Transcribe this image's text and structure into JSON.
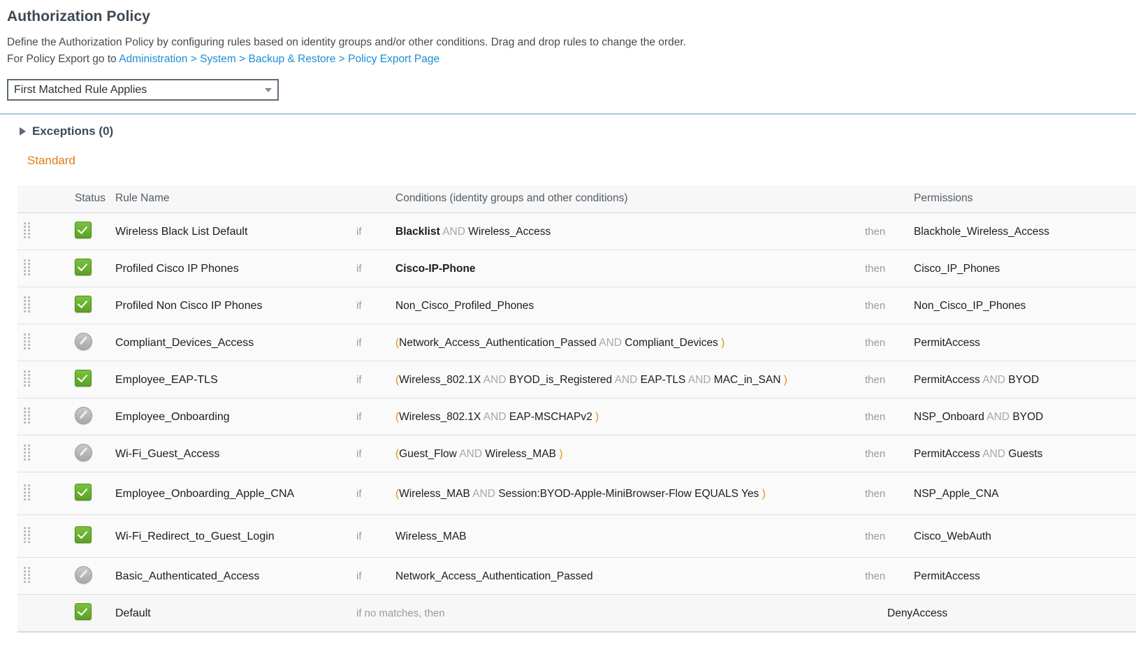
{
  "header": {
    "title": "Authorization Policy",
    "description_line1": "Define the Authorization Policy by configuring rules based on identity groups and/or other conditions. Drag and drop rules to change the order.",
    "description_prefix": "For Policy Export go to ",
    "breadcrumb": [
      {
        "label": "Administration"
      },
      {
        "label": "System"
      },
      {
        "label": "Backup & Restore"
      },
      {
        "label": "Policy Export Page"
      }
    ],
    "breadcrumb_separator": " > "
  },
  "rule_mode_select": {
    "value": "First Matched Rule Applies",
    "icon": "chevron-down-icon"
  },
  "exceptions": {
    "label": "Exceptions (0)",
    "expand_icon": "triangle-right-icon",
    "expanded": false
  },
  "standard_tab": {
    "label": "Standard"
  },
  "colors": {
    "accent_orange": "#e07b18",
    "link_blue": "#1a8fd4",
    "enabled_green": "#6ab32c",
    "disabled_gray": "#b4b4b4",
    "divider_blue": "#a9cbdd",
    "paren_orange": "#e8900f",
    "and_gray": "#a8a8a8"
  },
  "table": {
    "columns": {
      "status": "Status",
      "rule_name": "Rule Name",
      "conditions": "Conditions (identity groups and other conditions)",
      "permissions": "Permissions"
    },
    "keywords": {
      "if": "if",
      "then": "then",
      "if_no_matches": "if no matches, then"
    },
    "rows": [
      {
        "status": "enabled",
        "status_icon": "check-green-icon",
        "name": "Wireless Black List Default",
        "condition_parts": [
          {
            "text": "Blacklist",
            "style": "bold"
          },
          {
            "text": "AND",
            "style": "and"
          },
          {
            "text": "Wireless_Access",
            "style": "normal"
          }
        ],
        "permission_parts": [
          {
            "text": "Blackhole_Wireless_Access",
            "style": "normal"
          }
        ]
      },
      {
        "status": "enabled",
        "status_icon": "check-green-icon",
        "name": "Profiled Cisco IP Phones",
        "condition_parts": [
          {
            "text": "Cisco-IP-Phone",
            "style": "bold"
          }
        ],
        "permission_parts": [
          {
            "text": "Cisco_IP_Phones",
            "style": "normal"
          }
        ]
      },
      {
        "status": "enabled",
        "status_icon": "check-green-icon",
        "name": "Profiled Non Cisco IP Phones",
        "condition_parts": [
          {
            "text": "Non_Cisco_Profiled_Phones",
            "style": "normal"
          }
        ],
        "permission_parts": [
          {
            "text": "Non_Cisco_IP_Phones",
            "style": "normal"
          }
        ]
      },
      {
        "status": "disabled",
        "status_icon": "disabled-slash-icon",
        "name": "Compliant_Devices_Access",
        "condition_parts": [
          {
            "text": "(",
            "style": "paren"
          },
          {
            "text": "Network_Access_Authentication_Passed",
            "style": "normal"
          },
          {
            "text": "AND",
            "style": "and"
          },
          {
            "text": "Compliant_Devices",
            "style": "normal"
          },
          {
            "text": ")",
            "style": "paren"
          }
        ],
        "permission_parts": [
          {
            "text": "PermitAccess",
            "style": "normal"
          }
        ]
      },
      {
        "status": "enabled",
        "status_icon": "check-green-icon",
        "name": "Employee_EAP-TLS",
        "condition_parts": [
          {
            "text": "(",
            "style": "paren"
          },
          {
            "text": "Wireless_802.1X",
            "style": "normal"
          },
          {
            "text": "AND",
            "style": "and"
          },
          {
            "text": "BYOD_is_Registered",
            "style": "normal"
          },
          {
            "text": "AND",
            "style": "and"
          },
          {
            "text": "EAP-TLS",
            "style": "normal"
          },
          {
            "text": "AND",
            "style": "and"
          },
          {
            "text": "MAC_in_SAN",
            "style": "normal"
          },
          {
            "text": ")",
            "style": "paren"
          }
        ],
        "permission_parts": [
          {
            "text": "PermitAccess",
            "style": "normal"
          },
          {
            "text": "AND",
            "style": "and"
          },
          {
            "text": "BYOD",
            "style": "normal"
          }
        ]
      },
      {
        "status": "disabled",
        "status_icon": "disabled-slash-icon",
        "name": "Employee_Onboarding",
        "condition_parts": [
          {
            "text": "(",
            "style": "paren"
          },
          {
            "text": "Wireless_802.1X",
            "style": "normal"
          },
          {
            "text": "AND",
            "style": "and"
          },
          {
            "text": "EAP-MSCHAPv2",
            "style": "normal"
          },
          {
            "text": ")",
            "style": "paren"
          }
        ],
        "permission_parts": [
          {
            "text": "NSP_Onboard",
            "style": "normal"
          },
          {
            "text": "AND",
            "style": "and"
          },
          {
            "text": "BYOD",
            "style": "normal"
          }
        ]
      },
      {
        "status": "disabled",
        "status_icon": "disabled-slash-icon",
        "name": "Wi-Fi_Guest_Access",
        "condition_parts": [
          {
            "text": "(",
            "style": "paren"
          },
          {
            "text": "Guest_Flow",
            "style": "normal"
          },
          {
            "text": "AND",
            "style": "and"
          },
          {
            "text": "Wireless_MAB",
            "style": "normal"
          },
          {
            "text": ")",
            "style": "paren"
          }
        ],
        "permission_parts": [
          {
            "text": "PermitAccess",
            "style": "normal"
          },
          {
            "text": "AND",
            "style": "and"
          },
          {
            "text": "Guests",
            "style": "normal"
          }
        ]
      },
      {
        "status": "enabled",
        "status_icon": "check-green-icon",
        "name": "Employee_Onboarding_Apple_CNA",
        "condition_parts": [
          {
            "text": "(",
            "style": "paren"
          },
          {
            "text": "Wireless_MAB",
            "style": "normal"
          },
          {
            "text": "AND",
            "style": "and"
          },
          {
            "text": "Session:BYOD-Apple-MiniBrowser-Flow EQUALS Yes",
            "style": "normal"
          },
          {
            "text": ")",
            "style": "paren"
          }
        ],
        "permission_parts": [
          {
            "text": "NSP_Apple_CNA",
            "style": "normal"
          }
        ]
      },
      {
        "status": "enabled",
        "status_icon": "check-green-icon",
        "name": "Wi-Fi_Redirect_to_Guest_Login",
        "condition_parts": [
          {
            "text": "Wireless_MAB",
            "style": "normal"
          }
        ],
        "permission_parts": [
          {
            "text": "Cisco_WebAuth",
            "style": "normal"
          }
        ]
      },
      {
        "status": "disabled",
        "status_icon": "disabled-slash-icon",
        "name": "Basic_Authenticated_Access",
        "condition_parts": [
          {
            "text": "Network_Access_Authentication_Passed",
            "style": "normal"
          }
        ],
        "permission_parts": [
          {
            "text": "PermitAccess",
            "style": "normal"
          }
        ]
      }
    ],
    "default_row": {
      "status": "enabled",
      "status_icon": "check-green-icon",
      "name": "Default",
      "condition_label": "if no matches, then",
      "permission": "DenyAccess"
    }
  }
}
